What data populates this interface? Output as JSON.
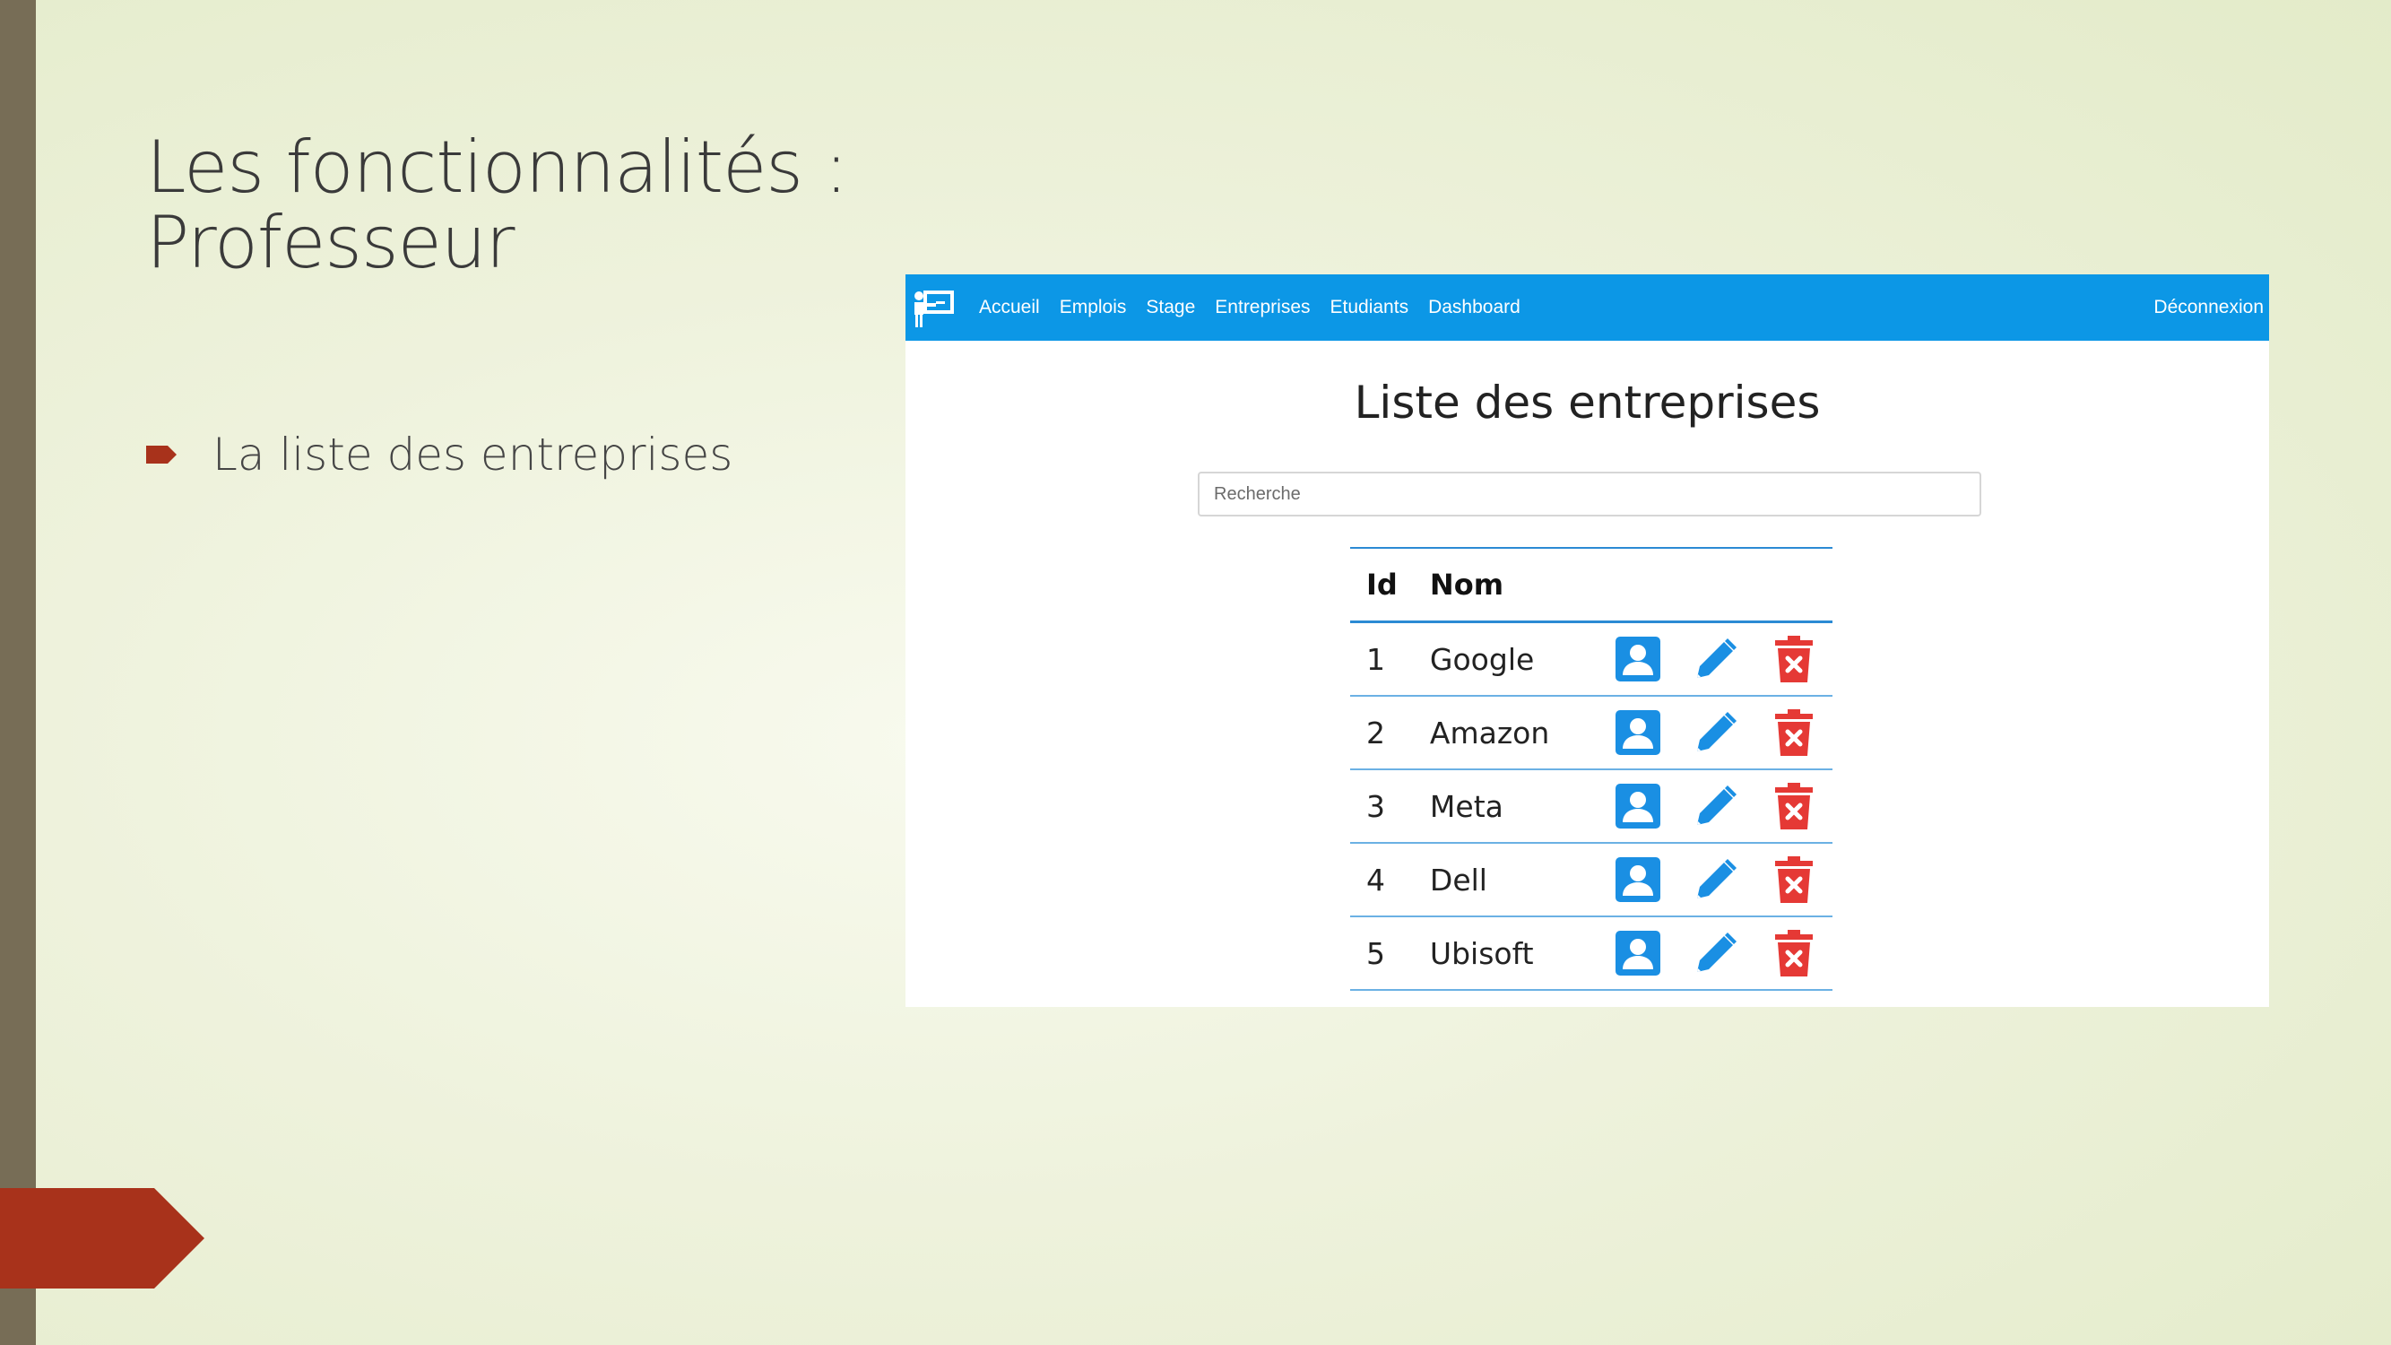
{
  "slide": {
    "title_line1": "Les fonctionnalités :",
    "title_line2": "Professeur",
    "bullet": "La liste des entreprises"
  },
  "app": {
    "brand_icon": "teacher-board-icon",
    "nav": {
      "items": [
        "Accueil",
        "Emplois",
        "Stage",
        "Entreprises",
        "Etudiants",
        "Dashboard"
      ],
      "logout": "Déconnexion"
    },
    "heading": "Liste des entreprises",
    "search": {
      "placeholder": "Recherche",
      "value": ""
    },
    "table": {
      "columns": [
        "Id",
        "Nom"
      ],
      "rows": [
        {
          "id": "1",
          "name": "Google"
        },
        {
          "id": "2",
          "name": "Amazon"
        },
        {
          "id": "3",
          "name": "Meta"
        },
        {
          "id": "4",
          "name": "Dell"
        },
        {
          "id": "5",
          "name": "Ubisoft"
        }
      ],
      "row_actions": [
        "contact-card-icon",
        "edit-pencil-icon",
        "delete-trash-icon"
      ]
    },
    "colors": {
      "navbar": "#0c97e6",
      "action_blue": "#1a8fe3",
      "delete_red": "#e53935",
      "accent": "#a8321b"
    }
  }
}
